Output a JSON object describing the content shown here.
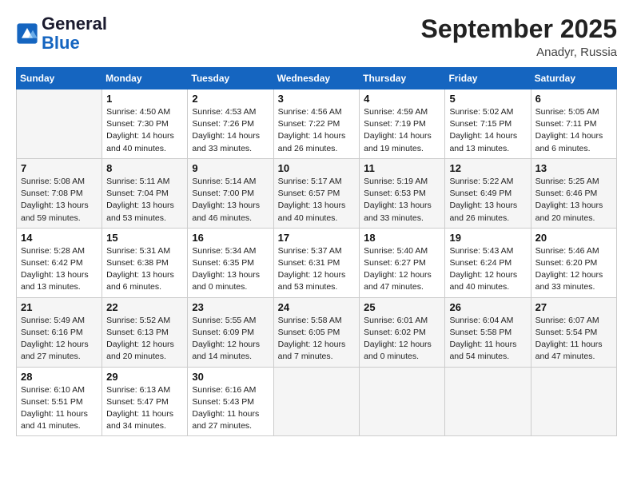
{
  "header": {
    "logo_line1": "General",
    "logo_line2": "Blue",
    "month_year": "September 2025",
    "location": "Anadyr, Russia"
  },
  "columns": [
    "Sunday",
    "Monday",
    "Tuesday",
    "Wednesday",
    "Thursday",
    "Friday",
    "Saturday"
  ],
  "weeks": [
    [
      {
        "day": "",
        "info": ""
      },
      {
        "day": "1",
        "info": "Sunrise: 4:50 AM\nSunset: 7:30 PM\nDaylight: 14 hours\nand 40 minutes."
      },
      {
        "day": "2",
        "info": "Sunrise: 4:53 AM\nSunset: 7:26 PM\nDaylight: 14 hours\nand 33 minutes."
      },
      {
        "day": "3",
        "info": "Sunrise: 4:56 AM\nSunset: 7:22 PM\nDaylight: 14 hours\nand 26 minutes."
      },
      {
        "day": "4",
        "info": "Sunrise: 4:59 AM\nSunset: 7:19 PM\nDaylight: 14 hours\nand 19 minutes."
      },
      {
        "day": "5",
        "info": "Sunrise: 5:02 AM\nSunset: 7:15 PM\nDaylight: 14 hours\nand 13 minutes."
      },
      {
        "day": "6",
        "info": "Sunrise: 5:05 AM\nSunset: 7:11 PM\nDaylight: 14 hours\nand 6 minutes."
      }
    ],
    [
      {
        "day": "7",
        "info": "Sunrise: 5:08 AM\nSunset: 7:08 PM\nDaylight: 13 hours\nand 59 minutes."
      },
      {
        "day": "8",
        "info": "Sunrise: 5:11 AM\nSunset: 7:04 PM\nDaylight: 13 hours\nand 53 minutes."
      },
      {
        "day": "9",
        "info": "Sunrise: 5:14 AM\nSunset: 7:00 PM\nDaylight: 13 hours\nand 46 minutes."
      },
      {
        "day": "10",
        "info": "Sunrise: 5:17 AM\nSunset: 6:57 PM\nDaylight: 13 hours\nand 40 minutes."
      },
      {
        "day": "11",
        "info": "Sunrise: 5:19 AM\nSunset: 6:53 PM\nDaylight: 13 hours\nand 33 minutes."
      },
      {
        "day": "12",
        "info": "Sunrise: 5:22 AM\nSunset: 6:49 PM\nDaylight: 13 hours\nand 26 minutes."
      },
      {
        "day": "13",
        "info": "Sunrise: 5:25 AM\nSunset: 6:46 PM\nDaylight: 13 hours\nand 20 minutes."
      }
    ],
    [
      {
        "day": "14",
        "info": "Sunrise: 5:28 AM\nSunset: 6:42 PM\nDaylight: 13 hours\nand 13 minutes."
      },
      {
        "day": "15",
        "info": "Sunrise: 5:31 AM\nSunset: 6:38 PM\nDaylight: 13 hours\nand 6 minutes."
      },
      {
        "day": "16",
        "info": "Sunrise: 5:34 AM\nSunset: 6:35 PM\nDaylight: 13 hours\nand 0 minutes."
      },
      {
        "day": "17",
        "info": "Sunrise: 5:37 AM\nSunset: 6:31 PM\nDaylight: 12 hours\nand 53 minutes."
      },
      {
        "day": "18",
        "info": "Sunrise: 5:40 AM\nSunset: 6:27 PM\nDaylight: 12 hours\nand 47 minutes."
      },
      {
        "day": "19",
        "info": "Sunrise: 5:43 AM\nSunset: 6:24 PM\nDaylight: 12 hours\nand 40 minutes."
      },
      {
        "day": "20",
        "info": "Sunrise: 5:46 AM\nSunset: 6:20 PM\nDaylight: 12 hours\nand 33 minutes."
      }
    ],
    [
      {
        "day": "21",
        "info": "Sunrise: 5:49 AM\nSunset: 6:16 PM\nDaylight: 12 hours\nand 27 minutes."
      },
      {
        "day": "22",
        "info": "Sunrise: 5:52 AM\nSunset: 6:13 PM\nDaylight: 12 hours\nand 20 minutes."
      },
      {
        "day": "23",
        "info": "Sunrise: 5:55 AM\nSunset: 6:09 PM\nDaylight: 12 hours\nand 14 minutes."
      },
      {
        "day": "24",
        "info": "Sunrise: 5:58 AM\nSunset: 6:05 PM\nDaylight: 12 hours\nand 7 minutes."
      },
      {
        "day": "25",
        "info": "Sunrise: 6:01 AM\nSunset: 6:02 PM\nDaylight: 12 hours\nand 0 minutes."
      },
      {
        "day": "26",
        "info": "Sunrise: 6:04 AM\nSunset: 5:58 PM\nDaylight: 11 hours\nand 54 minutes."
      },
      {
        "day": "27",
        "info": "Sunrise: 6:07 AM\nSunset: 5:54 PM\nDaylight: 11 hours\nand 47 minutes."
      }
    ],
    [
      {
        "day": "28",
        "info": "Sunrise: 6:10 AM\nSunset: 5:51 PM\nDaylight: 11 hours\nand 41 minutes."
      },
      {
        "day": "29",
        "info": "Sunrise: 6:13 AM\nSunset: 5:47 PM\nDaylight: 11 hours\nand 34 minutes."
      },
      {
        "day": "30",
        "info": "Sunrise: 6:16 AM\nSunset: 5:43 PM\nDaylight: 11 hours\nand 27 minutes."
      },
      {
        "day": "",
        "info": ""
      },
      {
        "day": "",
        "info": ""
      },
      {
        "day": "",
        "info": ""
      },
      {
        "day": "",
        "info": ""
      }
    ]
  ]
}
